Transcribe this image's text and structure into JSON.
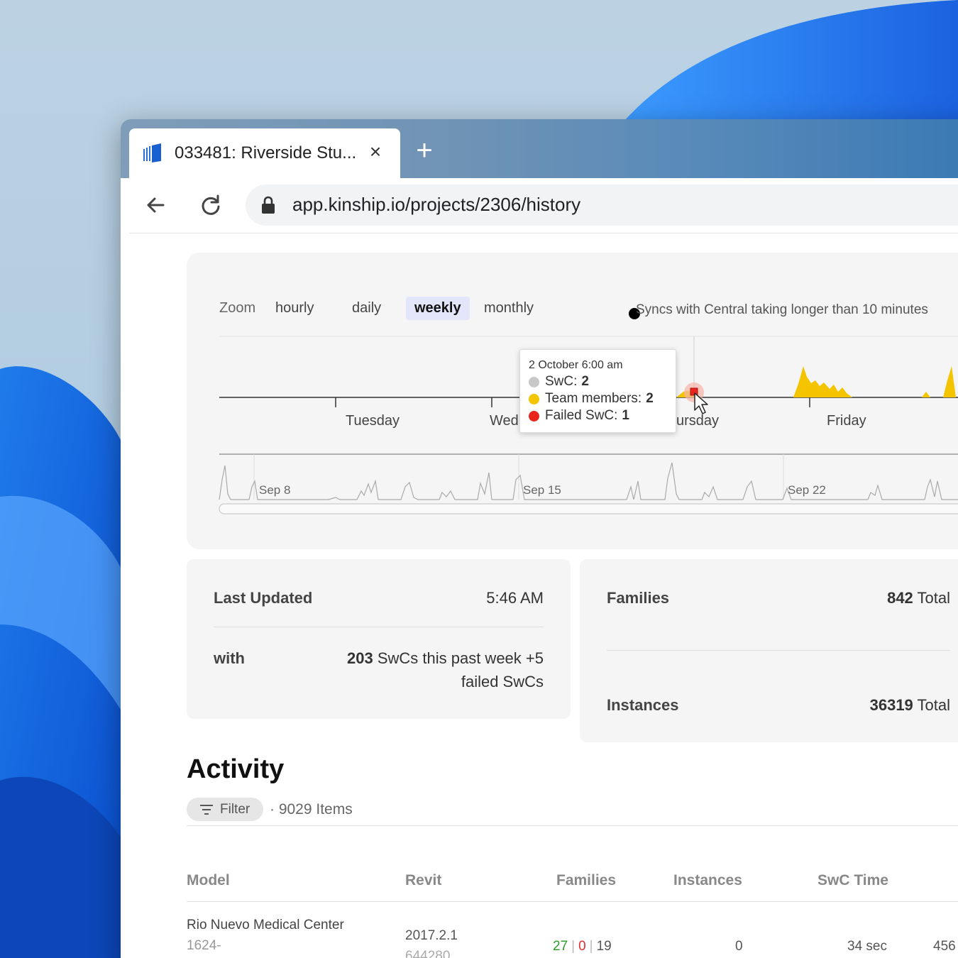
{
  "browser": {
    "tab_title": "033481: Riverside Stu...",
    "url": "app.kinship.io/projects/2306/history"
  },
  "chart": {
    "zoom_label": "Zoom",
    "zoom_options": [
      "hourly",
      "daily",
      "weekly",
      "monthly"
    ],
    "zoom_active": "weekly",
    "legend": "Syncs with Central taking longer than 10 minutes",
    "day_labels": [
      "Tuesday",
      "Wed",
      "ursday",
      "Friday"
    ],
    "navigator_labels": [
      "Sep 8",
      "Sep 15",
      "Sep 22"
    ],
    "tooltip": {
      "title": "2 October 6:00 am",
      "swc_label": "SwC:",
      "swc_value": "2",
      "team_label": "Team members:",
      "team_value": "2",
      "failed_label": "Failed SwC:",
      "failed_value": "1"
    },
    "colors": {
      "swc": "#c8c8c8",
      "team": "#f5c400",
      "failed": "#e8261e"
    }
  },
  "stats": {
    "last_updated_label": "Last Updated",
    "last_updated_value": "5:46 AM",
    "with_label": "with",
    "with_count": "203",
    "with_text_1": "SwCs this past week +5",
    "with_text_2": "failed SwCs",
    "families_label": "Families",
    "families_count": "842",
    "families_total": "Total",
    "instances_label": "Instances",
    "instances_count": "36319",
    "instances_total": "Total"
  },
  "activity": {
    "title": "Activity",
    "filter_label": "Filter",
    "items_count": "· 9029 Items",
    "columns": [
      "Model",
      "Revit",
      "Families",
      "Instances",
      "SwC Time"
    ],
    "rows": [
      {
        "model": "Rio Nuevo Medical Center",
        "model_sub": "1624-",
        "revit": "2017.2.1",
        "revit_sub": "644280",
        "families_added": "27",
        "families_removed": "0",
        "families_modified": "19",
        "instances": "0",
        "swc_time": "34 sec",
        "extra": "456"
      }
    ]
  }
}
